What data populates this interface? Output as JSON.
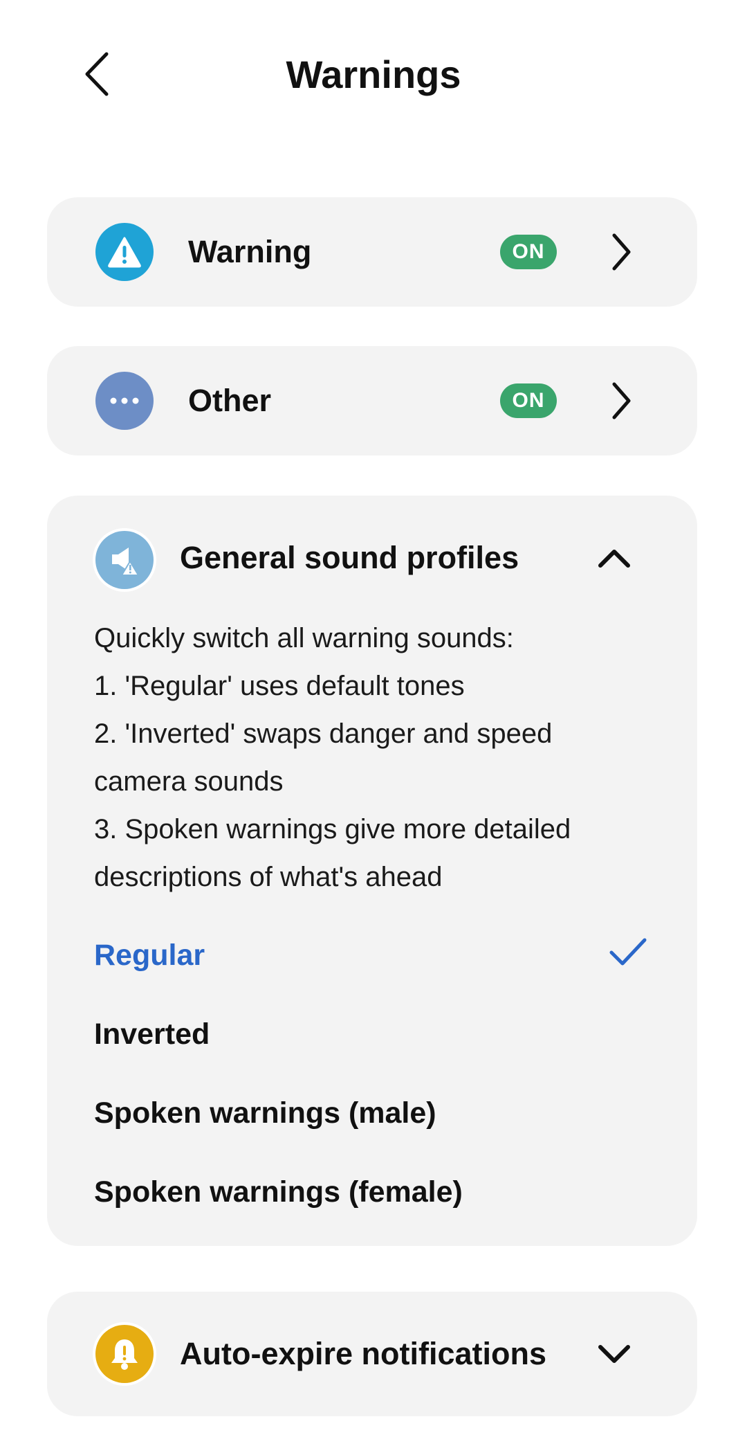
{
  "header": {
    "title": "Warnings",
    "back_icon": "chevron-left-icon"
  },
  "rows": [
    {
      "label": "Warning",
      "status": "ON",
      "icon": "warning-triangle-icon",
      "icon_color": "#1fa3d6",
      "status_color": "#3aa56c"
    },
    {
      "label": "Other",
      "status": "ON",
      "icon": "more-dots-icon",
      "icon_color": "#6d8ec6",
      "status_color": "#3aa56c"
    }
  ],
  "sound_profiles": {
    "title": "General sound profiles",
    "icon": "speaker-warning-icon",
    "icon_color": "#7fb4d9",
    "expanded": true,
    "description": [
      "Quickly switch all warning sounds:",
      "1. 'Regular' uses default tones",
      "2. 'Inverted' swaps danger and speed",
      "camera sounds",
      "3. Spoken warnings give more detailed",
      "descriptions of what's ahead"
    ],
    "options": [
      {
        "label": "Regular",
        "selected": true
      },
      {
        "label": "Inverted",
        "selected": false
      },
      {
        "label": "Spoken warnings (male)",
        "selected": false
      },
      {
        "label": "Spoken warnings (female)",
        "selected": false
      }
    ],
    "selected_color": "#2a67c9"
  },
  "auto_expire": {
    "title": "Auto-expire notifications",
    "icon": "bell-warning-icon",
    "icon_color": "#e6ad12",
    "expanded": false
  }
}
